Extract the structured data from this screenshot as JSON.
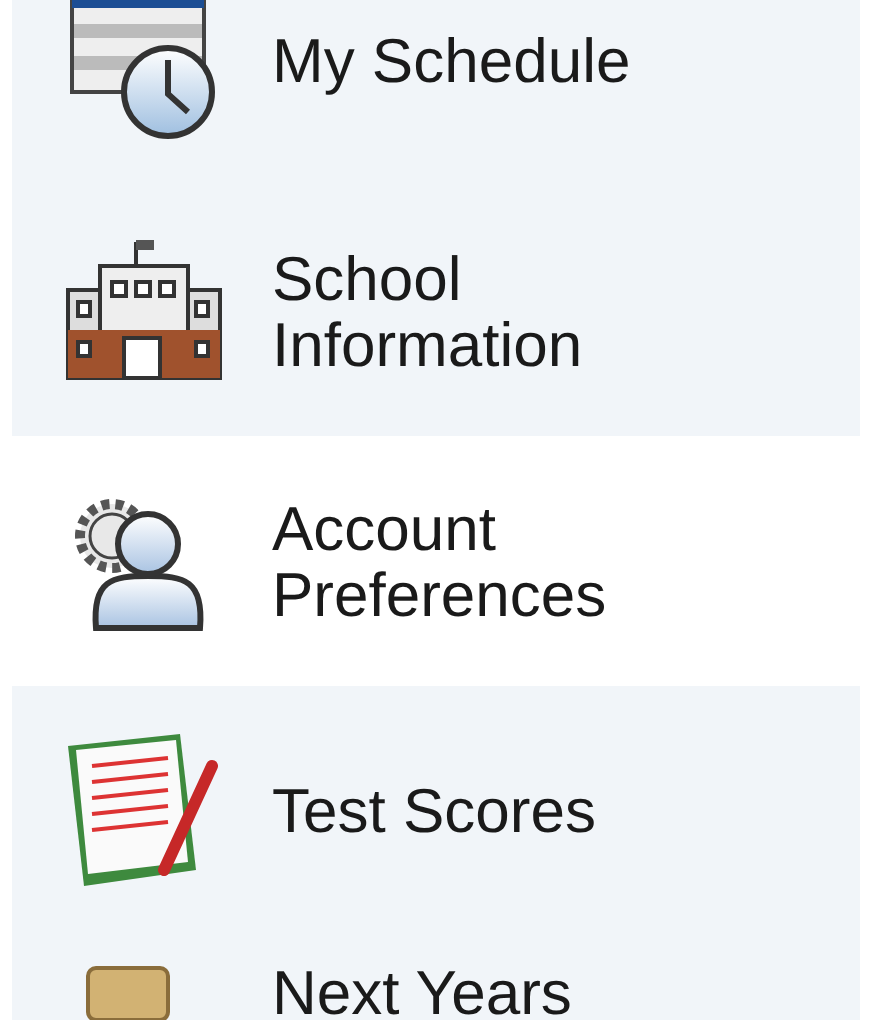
{
  "menu": {
    "items": [
      {
        "label": "My Schedule",
        "selected": false
      },
      {
        "label": "School Information",
        "selected": false
      },
      {
        "label": "Account Preferences",
        "selected": true
      },
      {
        "label": "Test Scores",
        "selected": false
      },
      {
        "label": "Next Years",
        "selected": false
      }
    ]
  }
}
